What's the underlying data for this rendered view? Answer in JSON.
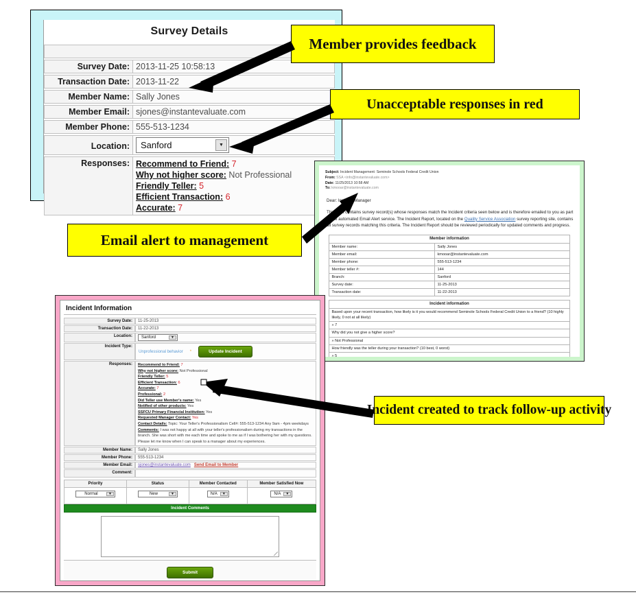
{
  "survey": {
    "title": "Survey Details",
    "fields": [
      {
        "label": "Survey Date:",
        "value": "2013-11-25 10:58:13"
      },
      {
        "label": "Transaction Date:",
        "value": "2013-11-22"
      },
      {
        "label": "Member Name:",
        "value": "Sally Jones"
      },
      {
        "label": "Member Email:",
        "value": "sjones@instantevaluate.com"
      },
      {
        "label": "Member Phone:",
        "value": "555-513-1234"
      }
    ],
    "location_label": "Location:",
    "location_value": "Sanford",
    "responses_label": "Responses:",
    "responses": [
      {
        "q": "Recommend to Friend:",
        "a": "7",
        "red": true
      },
      {
        "q": "Why not higher score:",
        "a": "Not Professional",
        "red": false
      },
      {
        "q": "Friendly Teller:",
        "a": "5",
        "red": true
      },
      {
        "q": "Efficient Transaction:",
        "a": "6",
        "red": true
      },
      {
        "q": "Accurate:",
        "a": "7",
        "red": true
      }
    ]
  },
  "email": {
    "subject_label": "Subject:",
    "subject": "Incident Management: Seminole Schools Federal Credit Union",
    "from_label": "From:",
    "from": "SSA <info@instantevaluate.com>",
    "date_label": "Date:",
    "date": "11/25/2013 10:58 AM",
    "to_label": "To:",
    "to": "kmooar@instantevaluate.com",
    "greeting": "Dear: Incident Manager",
    "body_1": "This alert contains survey record(s) whose responses match the Incident criteria seen below and is therefore emailed to you as part of the automated Email Alert service. The Incident Report, located on the",
    "body_link": "Quality Service Association",
    "body_2": "survey reporting site, contains all survey records matching this criteria. The Incident Report should be reviewed periodically for updated comments and progress.",
    "member_info_header": "Member information",
    "member_info": [
      {
        "k": "Member name:",
        "v": "Sally Jones"
      },
      {
        "k": "Member email:",
        "v": "kmooar@instantevaluate.com"
      },
      {
        "k": "Member phone:",
        "v": "555-513-1234"
      },
      {
        "k": "Member teller #:",
        "v": "144"
      },
      {
        "k": "Branch:",
        "v": "Sanford"
      },
      {
        "k": "Survey date:",
        "v": "11-25-2013"
      },
      {
        "k": "Transaction date:",
        "v": "11-22-2013"
      }
    ],
    "incident_info_header": "Incident information",
    "qa": [
      {
        "q": "Based upon your recent transaction, how likely is it you would recommend Seminole Schools Federal Credit Union to a friend? (10 highly likely, 0 not at all likely)",
        "a": "» 7"
      },
      {
        "q": "Why did you not give a higher score?",
        "a": "» Not Professional"
      },
      {
        "q": "How friendly was the teller during your transaction? (10 best, 0 worst)",
        "a": "» 5"
      }
    ]
  },
  "incident": {
    "title": "Incident Information",
    "fields": [
      {
        "label": "Survey Date:",
        "value": "11-25-2013"
      },
      {
        "label": "Transaction Date:",
        "value": "11-22-2013"
      }
    ],
    "location_label": "Location:",
    "location_value": "Sanford",
    "incident_type_label": "Incident Type:",
    "incident_type_value": "Unprofessional behavior",
    "incident_type_star": "*",
    "update_button": "Update Incident",
    "responses_label": "Responses:",
    "responses": [
      {
        "q": "Recommend to Friend:",
        "a": "7",
        "red": true
      },
      {
        "q": "Why not higher score:",
        "a": "Not Professional",
        "red": false
      },
      {
        "q": "Friendly Teller:",
        "a": "5",
        "red": true
      },
      {
        "q": "Efficient Transaction:",
        "a": "6",
        "red": true
      },
      {
        "q": "Accurate:",
        "a": "7",
        "red": true
      },
      {
        "q": "Professional:",
        "a": "2",
        "red": true
      },
      {
        "q": "Did Teller use Member's name:",
        "a": "Yes",
        "red": false
      },
      {
        "q": "Notified of other products:",
        "a": "Yes",
        "red": false
      },
      {
        "q": "SSFCU Primary Financial Institution:",
        "a": "Yes",
        "red": false
      },
      {
        "q": "Requested Manager Contact:",
        "a": "Yes",
        "red": true
      }
    ],
    "contact_details_label": "Contact Details:",
    "contact_details": "Topic: Your Teller's Professionalism Cell#: 555-513-1234 Any 9am - 4pm weekdays",
    "comments_label": "Comments:",
    "comments": "I was not happy at all with your teller's professionalism during my transactions in the branch. She was short with me each time and spoke to me as if I was bothering her with my questions. Please let me know when I can speak to a manager about my experiences.",
    "member_name_label": "Member Name:",
    "member_name": "Sally Jones",
    "member_phone_label": "Member Phone:",
    "member_phone": "555-513-1234",
    "member_email_label": "Member Email:",
    "member_email": "sjones@instantevaluate.com",
    "send_email_link": "Send Email to Member",
    "comment_label": "Comment:",
    "comment_value": "",
    "status_headers": [
      "Priority",
      "Status",
      "Member Contacted",
      "Member Satisfied Now"
    ],
    "status_values": [
      "Normal",
      "New",
      "N/A",
      "N/A"
    ],
    "incident_comments_bar": "Incident Comments",
    "incident_comments_value": "",
    "submit_button": "Submit"
  },
  "callouts": {
    "feedback": "Member provides feedback",
    "red_responses": "Unacceptable responses in red",
    "email_alert": "Email alert to management",
    "incident_created": "Incident created to track follow-up activity"
  },
  "colors": {
    "survey_frame": "#c9f4f8",
    "email_frame": "#ccf5cc",
    "incident_frame": "#f9a7c8",
    "callout": "#ffff00",
    "red_value": "#d4232b",
    "green_button": "#3f7000"
  }
}
